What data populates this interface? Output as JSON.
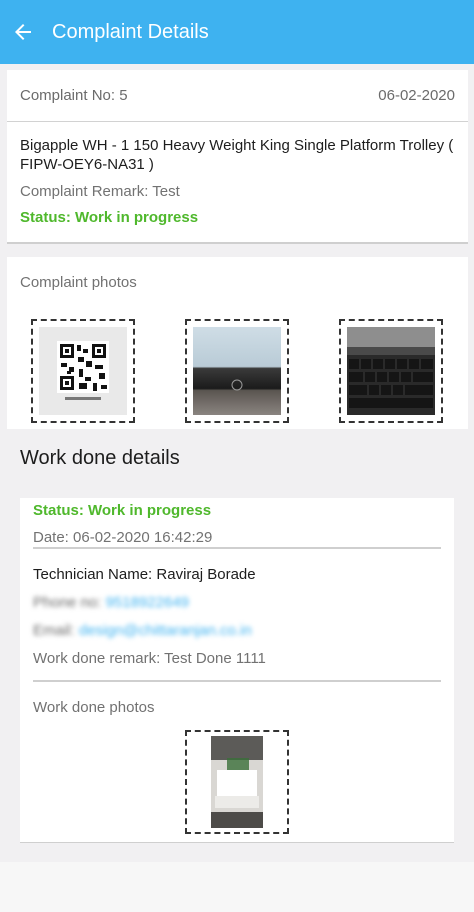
{
  "appbar": {
    "title": "Complaint Details",
    "back_icon": "arrow-left-icon"
  },
  "complaint": {
    "number_label": "Complaint No: 5",
    "date": "06-02-2020",
    "product": "Bigapple WH - 1 150 Heavy Weight King Single Platform Trolley ( FIPW-OEY6-NA31 )",
    "remark": "Complaint Remark: Test",
    "status": "Status: Work in progress"
  },
  "complaint_photos": {
    "label": "Complaint photos",
    "items": [
      "qr-code-photo",
      "laptop-hp-logo-photo",
      "keyboard-photo"
    ]
  },
  "work_done": {
    "title": "Work done details",
    "status": "Status: Work in progress",
    "date": "Date: 06-02-2020 16:42:29",
    "technician": "Technician Name: Raviraj Borade",
    "phone_label": "Phone no:",
    "phone_value": "9518922649",
    "email_label": "Email:",
    "email_value": "design@chittaranjan.co.in",
    "remark": "Work done remark: Test Done 1111",
    "photos_label": "Work done photos",
    "photos": [
      "trolley-box-photo"
    ]
  },
  "colors": {
    "accent": "#3eb2f0",
    "status": "#4fb82c"
  }
}
